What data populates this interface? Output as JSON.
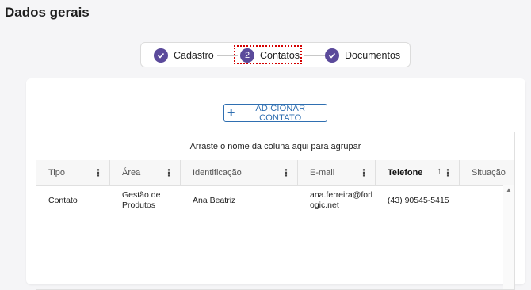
{
  "page": {
    "title": "Dados gerais"
  },
  "stepper": {
    "steps": [
      {
        "index": "1",
        "label": "Cadastro",
        "status": "done",
        "icon": "check-icon"
      },
      {
        "index": "2",
        "label": "Contatos",
        "status": "active",
        "icon": "number"
      },
      {
        "index": "3",
        "label": "Documentos",
        "status": "done",
        "icon": "check-icon"
      }
    ],
    "accent_color": "#5b4a9b"
  },
  "actions": {
    "add_contact_label": "ADICIONAR CONTATO",
    "add_icon": "plus-icon"
  },
  "grid": {
    "group_panel_text": "Arraste o nome da coluna aqui para agrupar",
    "columns": [
      {
        "label": "Tipo"
      },
      {
        "label": "Área"
      },
      {
        "label": "Identificação"
      },
      {
        "label": "E-mail"
      },
      {
        "label": "Telefone",
        "sorted": "asc"
      },
      {
        "label": "Situação"
      }
    ],
    "rows": [
      {
        "tipo": "Contato",
        "area": "Gestão de Produtos",
        "identificacao": "Ana Beatriz",
        "email": "ana.ferreira@forlogic.net",
        "telefone": "(43) 90545-5415",
        "situacao": ""
      }
    ]
  }
}
